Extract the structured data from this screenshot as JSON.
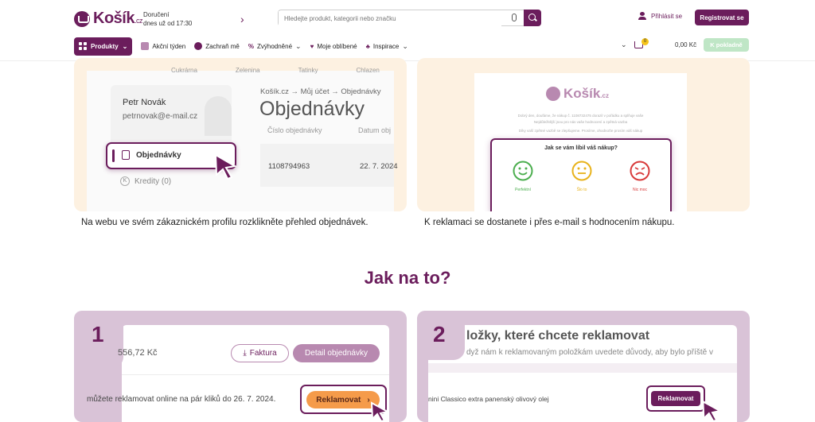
{
  "header": {
    "logo_text": "Košík",
    "logo_suffix": ".cz",
    "delivery_label": "Doručení",
    "delivery_time": "dnes už od 17:30",
    "search_placeholder": "Hledejte produkt, kategorii nebo značku",
    "login_label": "Přihlásit se",
    "register_label": "Registrovat se"
  },
  "nav": {
    "products": "Produkty",
    "items": [
      "Akční týden",
      "Zachraň mě",
      "Zvýhodněné",
      "Moje oblíbené",
      "Inspirace"
    ]
  },
  "cart": {
    "count": "0",
    "price": "0,00 Kč",
    "checkout_label": "K pokladně"
  },
  "card_a": {
    "categories": [
      "Cukrárna",
      "Zelenina",
      "Tatinky",
      "Chlazen"
    ],
    "user_name": "Petr Novák",
    "user_email": "petrnovak@e-mail.cz",
    "breadcrumb": "Košík.cz → Můj účet → Objednávky",
    "page_title": "Objednávky",
    "col_order_number": "Číslo objednávky",
    "col_date": "Datum obj",
    "menu_orders": "Objednávky",
    "menu_credits": "Kredity (0)",
    "order_number": "1108794963",
    "order_date": "22. 7. 2024",
    "caption": "Na webu ve svém zákaznickém profilu rozklikněte přehled objednávek."
  },
  "card_b": {
    "logo_text": "Košík",
    "logo_suffix": ".cz",
    "email_line1": "Dobrý den, doufáme, že nákup č. 1108732475 dorazil v pořádku a splňuje vaše",
    "email_line2": "Nejdůležitější jsou pro nás vaše hodnocení a zpětná vazba",
    "email_line3": "Díky vaší zpětné vazbě se zlepšujeme. Prosíme, ohodnoťte prosím váš nákup",
    "question": "Jak se vám líbil váš nákup?",
    "ratings": [
      "Perfektní",
      "Šlo to",
      "Nic moc"
    ],
    "caption": "K reklamaci se dostanete i přes e-mail s hodnocením nákupu."
  },
  "section_title": "Jak na to?",
  "step1": {
    "number": "1",
    "amount": "556,72 Kč",
    "invoice_label": "Faktura",
    "detail_label": "Detail objednávky",
    "notice": "můžete reklamovat online na pár kliků do 26. 7. 2024.",
    "claim_label": "Reklamovat"
  },
  "step2": {
    "number": "2",
    "heading": "ložky, které chcete reklamovat",
    "subtext": "dyž nám k reklamovaným položkám uvedete důvody, aby bylo příště v",
    "product": "nini Classico extra panenský olivový olej",
    "claim_label": "Reklamovat"
  },
  "colors": {
    "brand": "#6b1d5c",
    "accent_orange": "#f59b4a",
    "card_bg": "#fdf1e1",
    "step_bg": "#d9c3d7"
  }
}
